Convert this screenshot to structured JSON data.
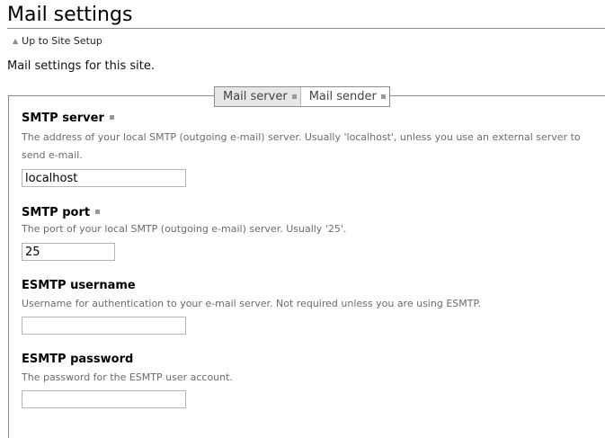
{
  "page": {
    "title": "Mail settings",
    "up_link": "Up to Site Setup",
    "description": "Mail settings for this site."
  },
  "tabs": [
    {
      "label": "Mail server",
      "active": true
    },
    {
      "label": "Mail sender",
      "active": false
    }
  ],
  "fields": {
    "smtp_server": {
      "label": "SMTP server",
      "required": true,
      "help": "The address of your local SMTP (outgoing e-mail) server. Usually 'localhost', unless you use an external server to send e-mail.",
      "value": "localhost"
    },
    "smtp_port": {
      "label": "SMTP port",
      "required": true,
      "help": "The port of your local SMTP (outgoing e-mail) server. Usually '25'.",
      "value": "25"
    },
    "esmtp_username": {
      "label": "ESMTP username",
      "required": false,
      "help": "Username for authentication to your e-mail server. Not required unless you are using ESMTP.",
      "value": ""
    },
    "esmtp_password": {
      "label": "ESMTP password",
      "required": false,
      "help": "The password for the ESMTP user account.",
      "value": ""
    }
  },
  "colors": {
    "active_tab_bg": "#e7e7e7",
    "help_text": "#6b6b6b",
    "border": "#8c8c8c"
  }
}
